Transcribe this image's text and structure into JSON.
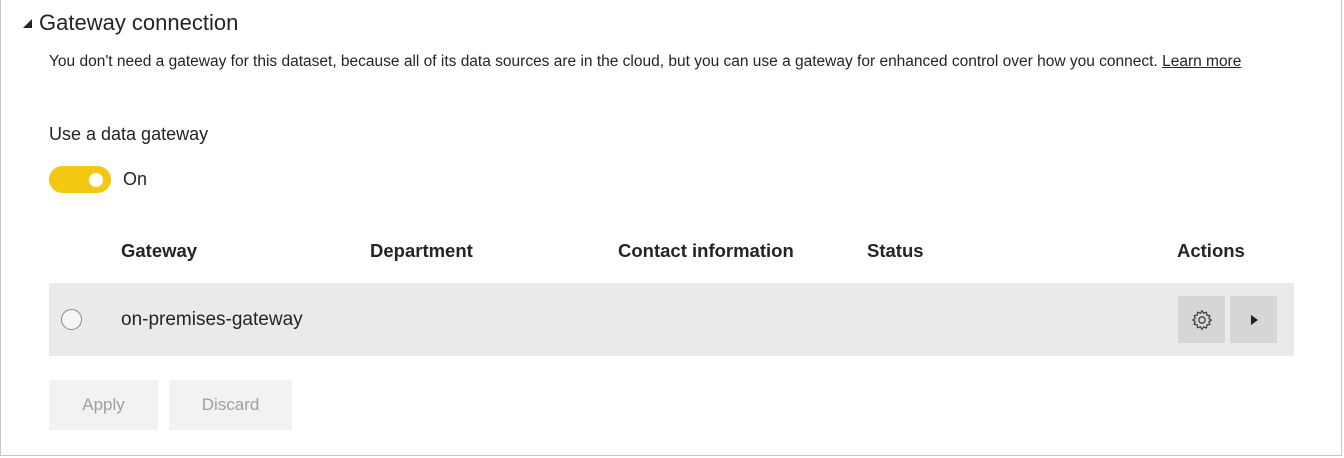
{
  "section": {
    "title": "Gateway connection",
    "description": "You don't need a gateway for this dataset, because all of its data sources are in the cloud, but you can use a gateway for enhanced control over how you connect.",
    "learn_more": "Learn more"
  },
  "gateway_setting": {
    "label": "Use a data gateway",
    "toggle_state": "On",
    "toggle_color": "#f2c811"
  },
  "table": {
    "columns": {
      "gateway": "Gateway",
      "department": "Department",
      "contact": "Contact information",
      "status": "Status",
      "actions": "Actions"
    },
    "rows": [
      {
        "name": "on-premises-gateway",
        "department": "",
        "contact": "",
        "status": "",
        "selected": false,
        "actions": [
          "gear-icon",
          "chevron-right-icon"
        ]
      }
    ]
  },
  "footer": {
    "apply_label": "Apply",
    "discard_label": "Discard"
  }
}
